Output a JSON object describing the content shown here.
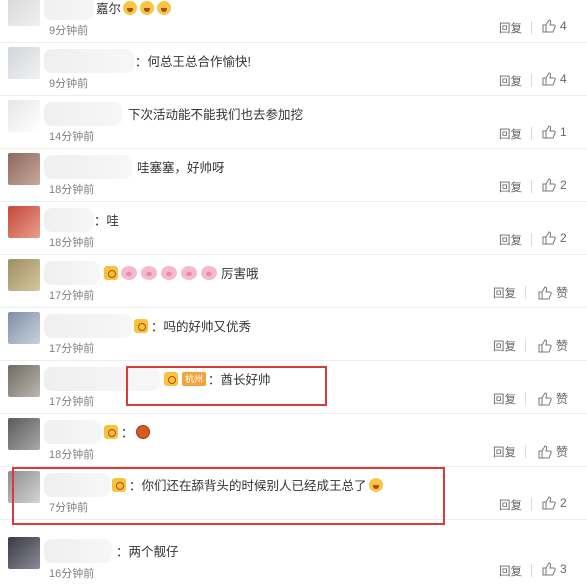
{
  "comments": [
    {
      "text": "嘉尔",
      "emoji": "face",
      "emoji_count": 3,
      "time": "9分钟前",
      "reply": "回复",
      "likes": "4"
    },
    {
      "text": "：何总王总合作愉快!",
      "time": "9分钟前",
      "reply": "回复",
      "likes": "4"
    },
    {
      "text": "下次活动能不能我们也去参加挖",
      "time": "14分钟前",
      "reply": "回复",
      "likes": "1"
    },
    {
      "text": "哇塞塞，好帅呀",
      "time": "18分钟前",
      "reply": "回复",
      "likes": "2"
    },
    {
      "text": "：哇",
      "time": "18分钟前",
      "reply": "回复",
      "likes": "2"
    },
    {
      "text": "厉害哦",
      "emoji": "pig",
      "emoji_count": 5,
      "time": "17分钟前",
      "reply": "回复",
      "likes": "赞"
    },
    {
      "text": "：吗的好帅又优秀",
      "time": "17分钟前",
      "reply": "回复",
      "likes": "赞"
    },
    {
      "text": "：酋长好帅",
      "city_badge": "杭州",
      "time": "17分钟前",
      "reply": "回复",
      "likes": "赞"
    },
    {
      "text": "：",
      "emoji": "round",
      "emoji_count": 1,
      "time": "18分钟前",
      "reply": "回复",
      "likes": "赞"
    },
    {
      "text": "：你们还在舔背头的时候别人已经成王总了",
      "time": "7分钟前",
      "reply": "回复",
      "likes": "2"
    },
    {
      "text": "：两个靓仔",
      "time": "16分钟前",
      "reply": "回复",
      "likes": "3"
    }
  ],
  "colors": {
    "highlight": "#d93a3a",
    "badge": "#f8c23a"
  }
}
